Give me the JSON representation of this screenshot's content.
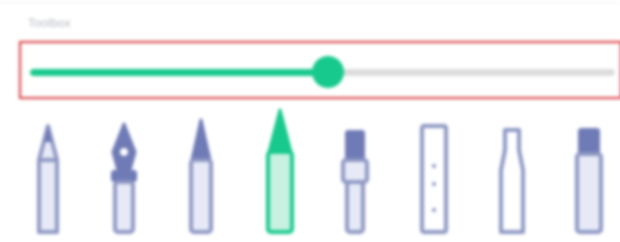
{
  "toolbox": {
    "title": "Toolbox",
    "size_slider": {
      "value": 0.51
    },
    "tools": [
      {
        "name": "pencil",
        "selected": false
      },
      {
        "name": "fountain-pen",
        "selected": false
      },
      {
        "name": "ballpoint-pen",
        "selected": false
      },
      {
        "name": "highlighter",
        "selected": true
      },
      {
        "name": "brush",
        "selected": false
      },
      {
        "name": "ruler",
        "selected": false
      },
      {
        "name": "eraser",
        "selected": false
      },
      {
        "name": "marker",
        "selected": false
      }
    ]
  },
  "colors": {
    "accent": "#17c98c",
    "tool_stroke": "#8d97c3",
    "tool_fill": "#e7eaf6",
    "tool_dark": "#6f7bb6",
    "selected_fill": "#c8f1e2",
    "selection_border": "#d9343a"
  }
}
